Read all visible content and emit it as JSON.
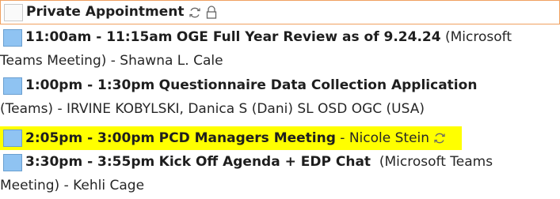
{
  "appointments": [
    {
      "title": "Private Appointment",
      "icons": [
        "recurring-icon",
        "lock-icon"
      ]
    },
    {
      "time": "11:00am - 11:15am",
      "title": "OGE Full Year Review as of 9.24.24",
      "location": "(Microsoft",
      "location_cont": "Teams Meeting) - Shawna L. Cale"
    },
    {
      "time": "1:00pm - 1:30pm",
      "title": "Questionnaire Data Collection Application",
      "location_cont": "(Teams) - IRVINE KOBYLSKI, Danica S (Dani) SL OSD OGC (USA)"
    },
    {
      "time": "2:05pm - 3:00pm",
      "title": "PCD Managers Meeting",
      "organizer": "- Nicole Stein",
      "highlight": "#ffff00",
      "icons": [
        "recurring-icon"
      ]
    },
    {
      "time": "3:30pm - 3:55pm",
      "title": "Kick Off Agenda + EDP Chat",
      "location": "(Microsoft Teams",
      "location_cont": "Meeting) - Kehli Cage"
    }
  ],
  "colors": {
    "category_blue": "#8fc3f2",
    "selection_border": "#f0a060",
    "highlight": "#ffff00"
  }
}
